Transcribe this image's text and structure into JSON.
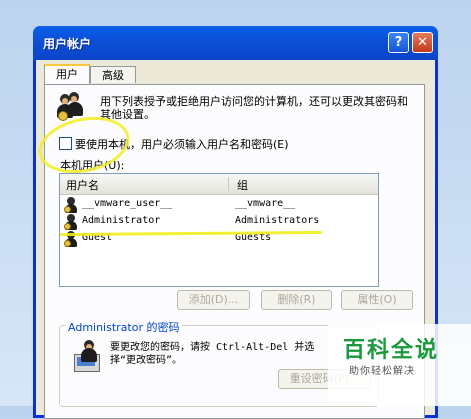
{
  "window": {
    "title": "用户帐户",
    "help_label": "?",
    "close_label": "✕"
  },
  "tabs": [
    {
      "label": "用户"
    },
    {
      "label": "高级"
    }
  ],
  "intro_text": "用下列表授予或拒绝用户访问您的计算机，还可以更改其密码和其他设置。",
  "require_login": {
    "label": "要使用本机，用户必须输入用户名和密码(E)",
    "checked": false
  },
  "users_group_label": "本机用户(U):",
  "columns": {
    "name": "用户名",
    "group": "组"
  },
  "users": [
    {
      "name": "__vmware_user__",
      "group": "__vmware__"
    },
    {
      "name": "Administrator",
      "group": "Administrators"
    },
    {
      "name": "Guest",
      "group": "Guests"
    }
  ],
  "buttons": {
    "add": "添加(D)...",
    "remove": "删除(R)",
    "properties": "属性(O)"
  },
  "password_section": {
    "title": "Administrator 的密码",
    "text": "要更改您的密码，请按 Ctrl-Alt-Del 并选择“更改密码”。",
    "reset_button": "重设密码(P)..."
  },
  "watermark": {
    "title": "百科全说",
    "subtitle": "助你轻松解决"
  }
}
